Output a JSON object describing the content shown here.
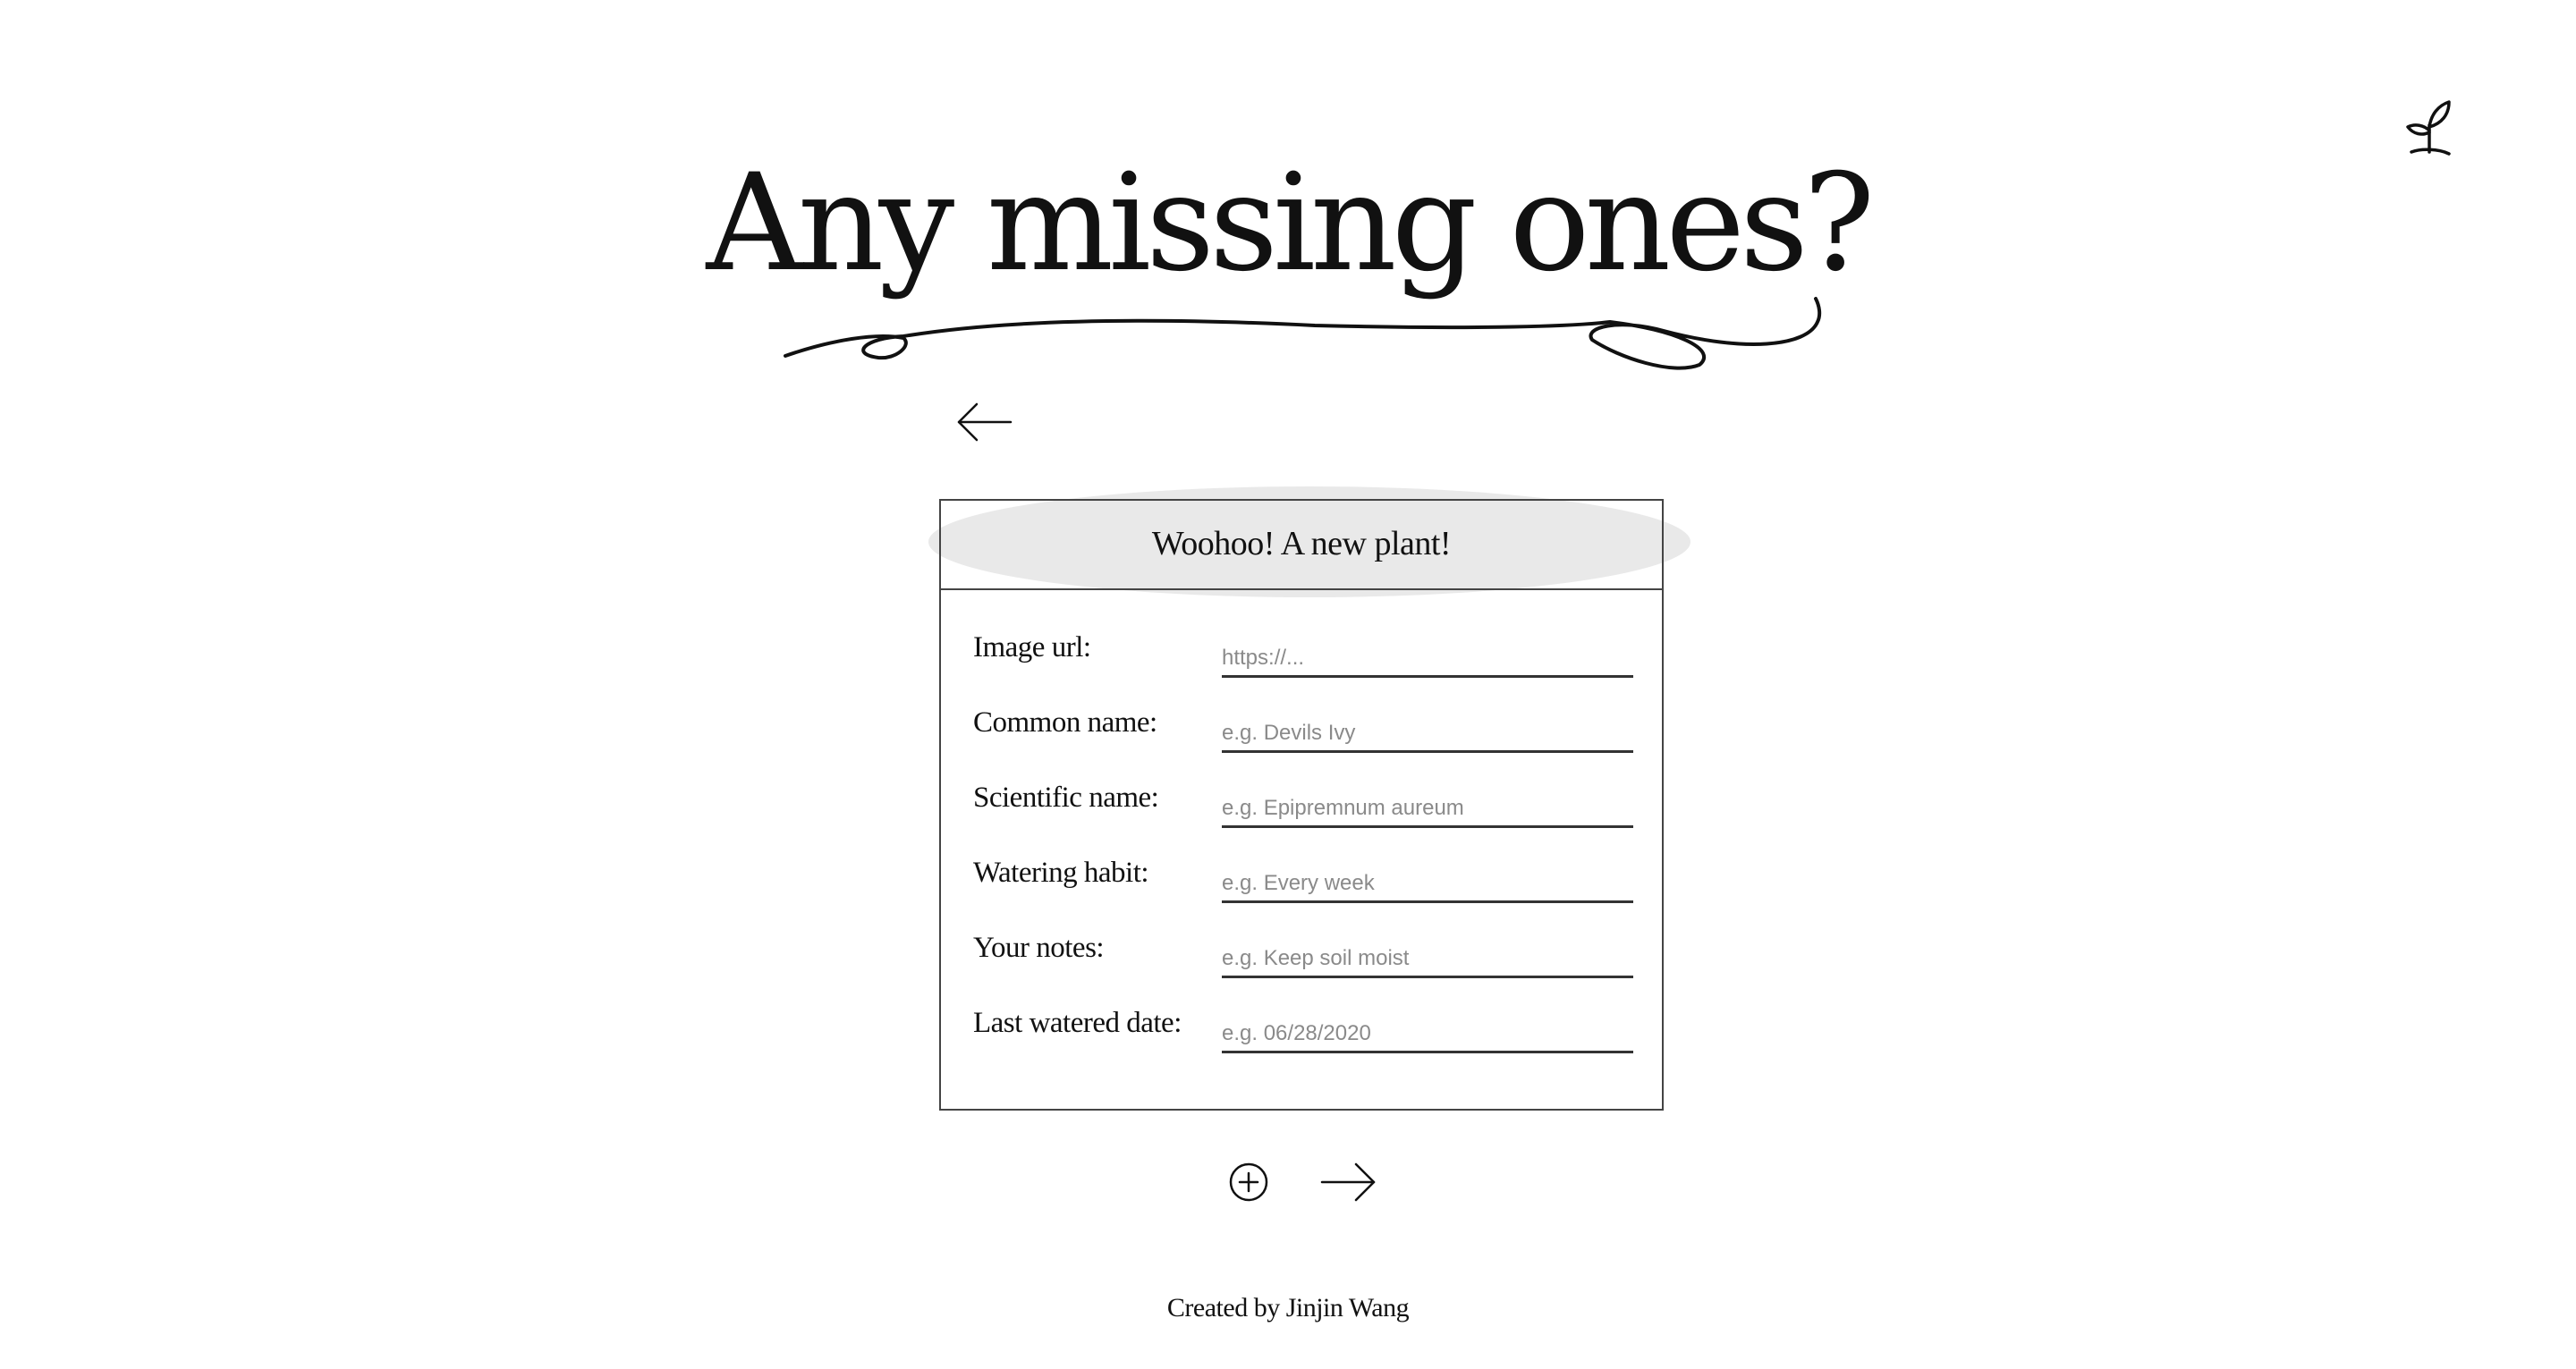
{
  "header": {
    "logo_icon": "sprout-icon"
  },
  "hero": {
    "title": "Any missing ones?"
  },
  "navigation": {
    "back_icon": "arrow-left-icon",
    "next_icon": "arrow-right-icon",
    "add_icon": "plus-circle-icon"
  },
  "form": {
    "title": "Woohoo!  A  new plant!",
    "fields": [
      {
        "label": "Image url:",
        "value": "",
        "placeholder": "https://..."
      },
      {
        "label": "Common name:",
        "value": "",
        "placeholder": "e.g. Devils Ivy"
      },
      {
        "label": "Scientific name:",
        "value": "",
        "placeholder": "e.g. Epipremnum aureum"
      },
      {
        "label": "Watering habit:",
        "value": "",
        "placeholder": "e.g. Every week"
      },
      {
        "label": "Your notes:",
        "value": "",
        "placeholder": "e.g. Keep soil moist"
      },
      {
        "label": "Last watered date:",
        "value": "",
        "placeholder": "e.g. 06/28/2020"
      }
    ]
  },
  "footer": {
    "credit": "Created by Jinjin Wang"
  },
  "colors": {
    "text": "#111111",
    "border": "#444444",
    "header_blob": "#e9e9e9",
    "placeholder": "#8a8a8a"
  }
}
